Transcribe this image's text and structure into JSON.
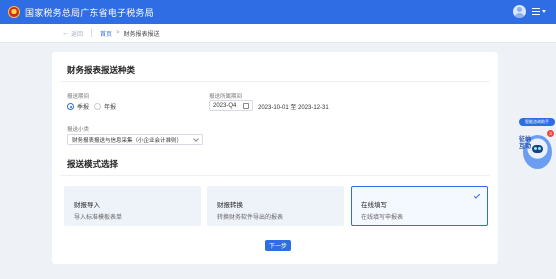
{
  "header": {
    "site_title": "国家税务总局广东省电子税务局"
  },
  "breadcrumb": {
    "back_label": "返回",
    "home": "首页",
    "separator": ">",
    "current": "财务报表报送"
  },
  "section1": {
    "title": "财务报表报送种类",
    "period_label": "报送期间",
    "radio_options": [
      {
        "label": "季报",
        "selected": true
      },
      {
        "label": "年报",
        "selected": false
      }
    ],
    "belong_label": "报送所属期间",
    "period_value": "2023-Q4",
    "date_range": "2023-10-01 至 2023-12-31",
    "subtype_label": "报送小类",
    "subtype_value": "财务报表报送与信息采集（小企业会计准则）"
  },
  "section2": {
    "title": "报送模式选择",
    "modes": [
      {
        "title": "财报导入",
        "desc": "导入标准模板表单",
        "selected": false
      },
      {
        "title": "财报转换",
        "desc": "转换财务软件导出的报表",
        "selected": false
      },
      {
        "title": "在线填写",
        "desc": "在线填写申报表",
        "selected": true
      }
    ]
  },
  "actions": {
    "next_label": "下一步"
  },
  "assistant": {
    "label": "智能咨询助手",
    "text": "征纳互动",
    "badge_count": "3"
  },
  "colors": {
    "brand": "#2f6de5",
    "background": "#eef1f6",
    "card": "#ffffff",
    "badge": "#f0463c"
  }
}
